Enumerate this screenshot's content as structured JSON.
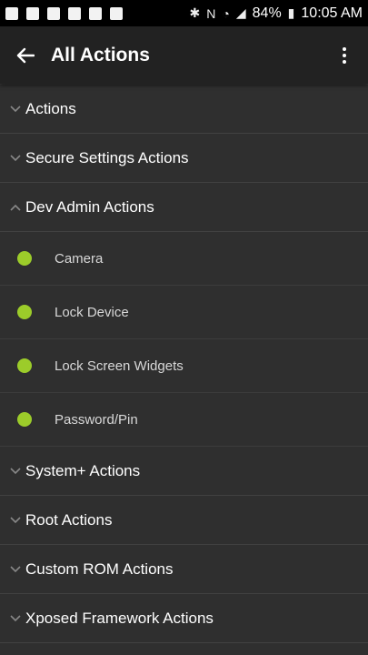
{
  "status_bar": {
    "battery": "84%",
    "time": "10:05 AM"
  },
  "app_bar": {
    "title": "All Actions"
  },
  "groups": [
    {
      "label": "Actions",
      "expanded": false
    },
    {
      "label": "Secure Settings Actions",
      "expanded": false
    },
    {
      "label": "Dev Admin Actions",
      "expanded": true,
      "children": [
        "Camera",
        "Lock Device",
        "Lock Screen Widgets",
        "Password/Pin"
      ]
    },
    {
      "label": "System+ Actions",
      "expanded": false
    },
    {
      "label": "Root Actions",
      "expanded": false
    },
    {
      "label": "Custom ROM Actions",
      "expanded": false
    },
    {
      "label": "Xposed Framework Actions",
      "expanded": false
    }
  ],
  "colors": {
    "accent_dot": "#9ccc2a",
    "background": "#2f2f2f",
    "app_bar": "#222222"
  }
}
